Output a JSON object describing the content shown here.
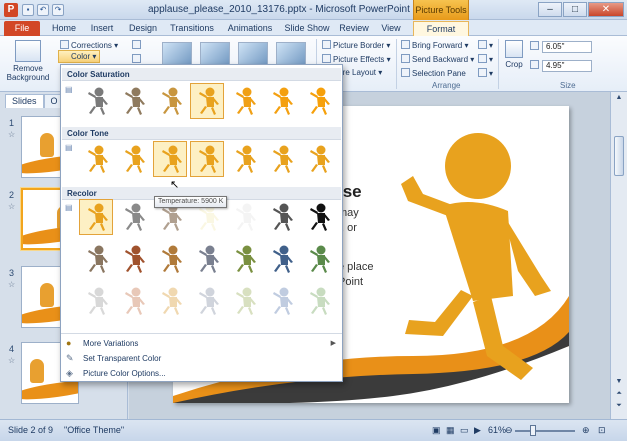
{
  "window": {
    "app_letter": "P",
    "title": "applause_please_2010_13176.pptx - Microsoft PowerPoint",
    "context_tab": "Picture Tools",
    "minimize": "–",
    "maximize": "□",
    "close": "✕"
  },
  "tabs": [
    "File",
    "Home",
    "Insert",
    "Design",
    "Transitions",
    "Animations",
    "Slide Show",
    "Review",
    "View",
    "Format"
  ],
  "ribbon": {
    "remove_background": "Remove Background",
    "corrections": "Corrections",
    "color": "Color",
    "picture_border": "Picture Border",
    "picture_effects": "Picture Effects",
    "picture_layout": "ture Layout",
    "bring_forward": "Bring Forward",
    "send_backward": "Send Backward",
    "selection_pane": "Selection Pane",
    "arrange_label": "Arrange",
    "crop": "Crop",
    "size_label": "Size",
    "height_value": "6.05\"",
    "width_value": "4.95\""
  },
  "slides_pane": {
    "tabs": [
      "Slides",
      "O"
    ],
    "slide_numbers": [
      "1",
      "2",
      "3",
      "4"
    ]
  },
  "slide_content": {
    "heading_partial": "lse",
    "lines": [
      "may",
      "t, or",
      "e place",
      "Point"
    ]
  },
  "color_menu": {
    "sections": [
      "Color Saturation",
      "Color Tone",
      "Recolor"
    ],
    "tooltip": "Temperature: 5900 K",
    "items": [
      "More Variations",
      "Set Transparent Color",
      "Picture Color Options..."
    ]
  },
  "status": {
    "slide_of": "Slide 2 of 9",
    "theme": "\"Office Theme\"",
    "zoom": "61%"
  },
  "colors": {
    "accent_orange": "#e89a1a",
    "file_tab": "#d24726",
    "ribbon_blue": "#1f3b63"
  }
}
